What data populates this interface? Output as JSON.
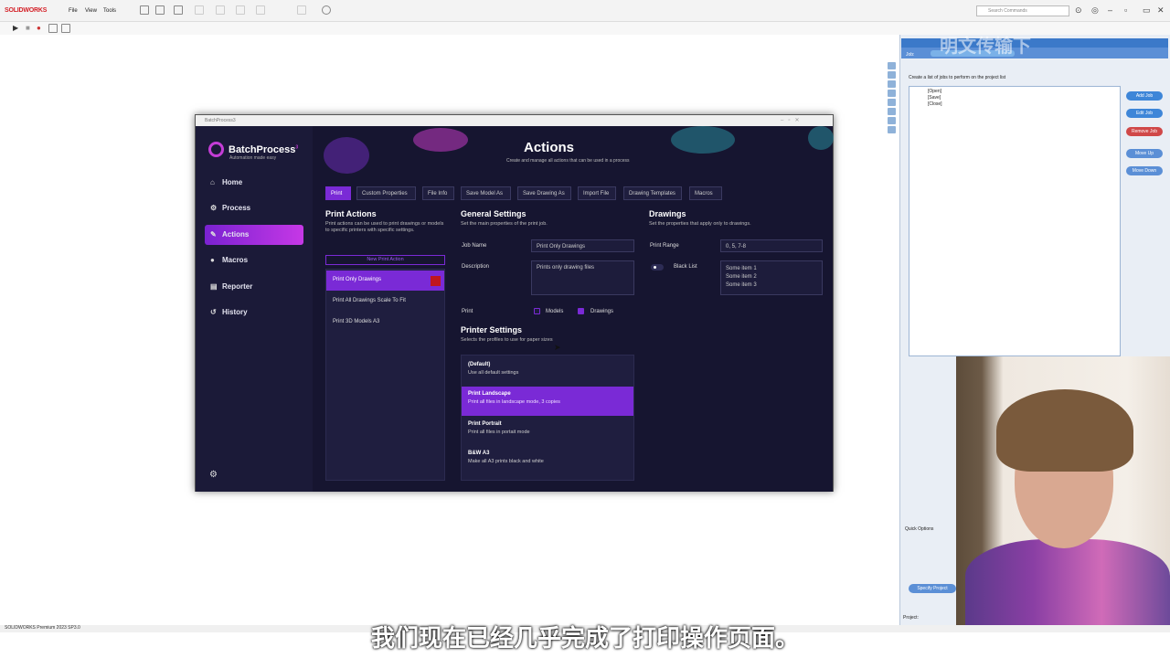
{
  "solidworks": {
    "logo": "SOLIDWORKS",
    "menus": [
      "File",
      "View",
      "Tools"
    ],
    "search_placeholder": "Search Commands",
    "status": "SOLIDWORKS Premium 2023 SP3.0"
  },
  "batchprocess": {
    "window_title": "BatchProcess3",
    "logo": "BatchProcess",
    "logo_super": "3",
    "tagline": "Automation made easy",
    "nav": [
      {
        "label": "Home",
        "icon": "home-icon"
      },
      {
        "label": "Process",
        "icon": "gear-icon"
      },
      {
        "label": "Actions",
        "icon": "wrench-icon",
        "active": true
      },
      {
        "label": "Macros",
        "icon": "circle-icon"
      },
      {
        "label": "Reporter",
        "icon": "document-icon"
      },
      {
        "label": "History",
        "icon": "history-icon"
      }
    ],
    "header": {
      "title": "Actions",
      "subtitle": "Create and manage all actions that can be used in a process"
    },
    "tabs": [
      "Print",
      "Custom Properties",
      "File Info",
      "Save Model As",
      "Save Drawing As",
      "Import File",
      "Drawing Templates",
      "Macros"
    ],
    "print_actions": {
      "title": "Print Actions",
      "desc": "Print actions can be used to print drawings or models to specific printers with specific settings.",
      "new_button": "New Print Action",
      "items": [
        "Print Only Drawings",
        "Print All Drawings Scale To Fit",
        "Print 3D Models A3"
      ]
    },
    "general": {
      "title": "General Settings",
      "desc": "Set the main properties of the print job.",
      "job_name_label": "Job Name",
      "job_name_value": "Print Only Drawings",
      "description_label": "Description",
      "description_value": "Prints only drawing files",
      "print_label": "Print",
      "models_label": "Models",
      "drawings_label": "Drawings"
    },
    "printer": {
      "title": "Printer Settings",
      "desc": "Selects the profiles to use for paper sizes",
      "profiles": [
        {
          "title": "(Default)",
          "desc": "Use all default settings"
        },
        {
          "title": "Print Landscape",
          "desc": "Print all files in landscape mode, 3 copies"
        },
        {
          "title": "Print Portrait",
          "desc": "Print all files in portait mode"
        },
        {
          "title": "B&W A3",
          "desc": "Make all A3 prints black and white"
        }
      ]
    },
    "drawings": {
      "title": "Drawings",
      "desc": "Set the properties that apply only to drawings.",
      "range_label": "Print Range",
      "range_value": "0, 5, 7-8",
      "blacklist_label": "Black List",
      "blacklist_items": [
        "Some item 1",
        "Some item 2",
        "Some item 3"
      ]
    }
  },
  "rightpane": {
    "job_label": "Job:",
    "hint": "Create a list of jobs to perform on the project list",
    "items": [
      "[Open]",
      "[Save]",
      "[Close]"
    ],
    "buttons": [
      "Add Job",
      "Edit Job",
      "Remove Job",
      "Move Up",
      "Move Down"
    ],
    "quick_options": "Quick Options",
    "specify": "Specify Project",
    "project": "Project:"
  },
  "subtitle": "我们现在已经几乎完成了打印操作页面。",
  "watermark": "明文传输下"
}
